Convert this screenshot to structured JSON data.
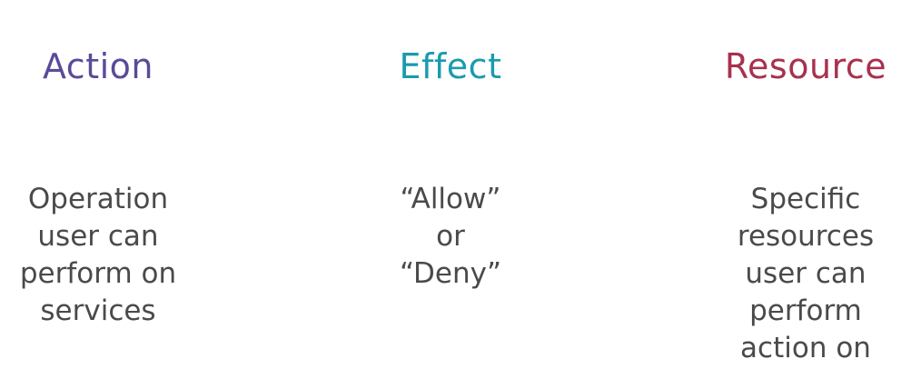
{
  "colors": {
    "action": "#5b4a98",
    "effect": "#1a9bae",
    "resource": "#a8314d",
    "body_text": "#4a4a4a",
    "background": "#ffffff"
  },
  "columns": [
    {
      "heading": "Action",
      "lines": [
        "Operation",
        "user can",
        "perform on",
        "services"
      ]
    },
    {
      "heading": "Effect",
      "lines": [
        "“Allow”",
        "or",
        "“Deny”"
      ]
    },
    {
      "heading": "Resource",
      "lines": [
        "Specific",
        "resources",
        "user can",
        "perform",
        "action on"
      ]
    }
  ]
}
